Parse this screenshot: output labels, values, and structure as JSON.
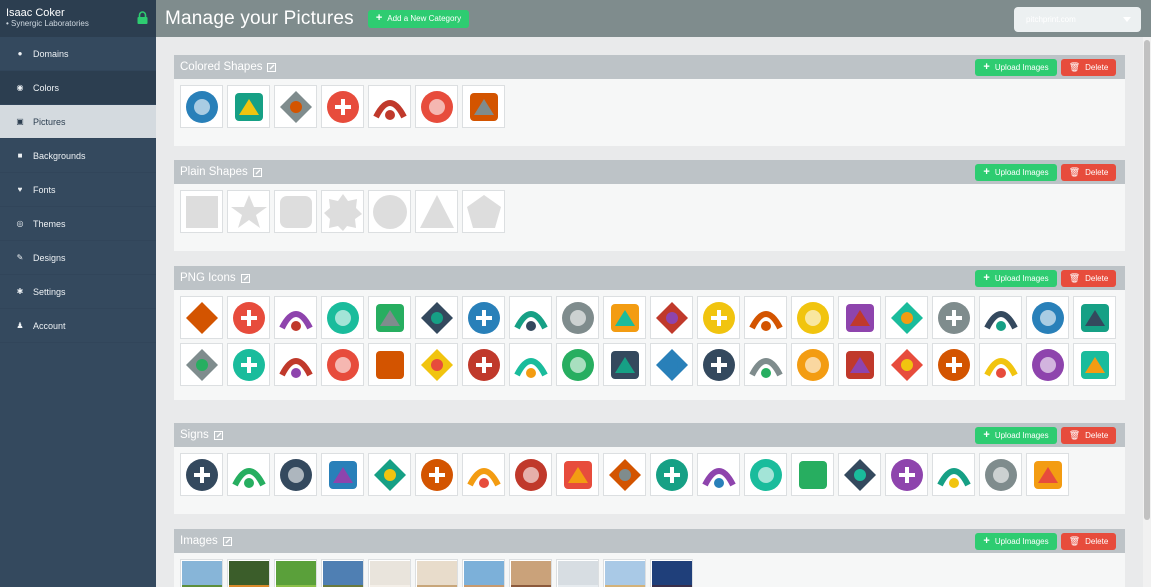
{
  "user": {
    "name": "Isaac Coker",
    "org": "• Synergic Laboratories"
  },
  "nav": [
    {
      "label": "Domains",
      "icon": "map-marker-icon",
      "glyph": "●"
    },
    {
      "label": "Colors",
      "icon": "target-icon",
      "glyph": "◉"
    },
    {
      "label": "Pictures",
      "icon": "picture-icon",
      "glyph": "▣"
    },
    {
      "label": "Backgrounds",
      "icon": "square-icon",
      "glyph": "■"
    },
    {
      "label": "Fonts",
      "icon": "heart-icon",
      "glyph": "♥"
    },
    {
      "label": "Themes",
      "icon": "eye-icon",
      "glyph": "◎"
    },
    {
      "label": "Designs",
      "icon": "edit-icon",
      "glyph": "✎"
    },
    {
      "label": "Settings",
      "icon": "gear-icon",
      "glyph": "✱"
    },
    {
      "label": "Account",
      "icon": "user-icon",
      "glyph": "♟"
    }
  ],
  "header": {
    "title": "Manage your Pictures",
    "add_label": "Add a New Category",
    "site": "pitchprint.com"
  },
  "buttons": {
    "upload": "Upload Images",
    "delete": "Delete"
  },
  "categories": [
    {
      "title": "Colored Shapes",
      "count": 7
    },
    {
      "title": "Plain Shapes",
      "count": 7
    },
    {
      "title": "PNG Icons",
      "count": 40
    },
    {
      "title": "Signs",
      "count": 19
    },
    {
      "title": "Images",
      "count": 11
    }
  ],
  "colors": {
    "sidebar": "#34495e",
    "topbar": "#7f8c8d",
    "green": "#2ecc71",
    "red": "#e74c3c"
  }
}
